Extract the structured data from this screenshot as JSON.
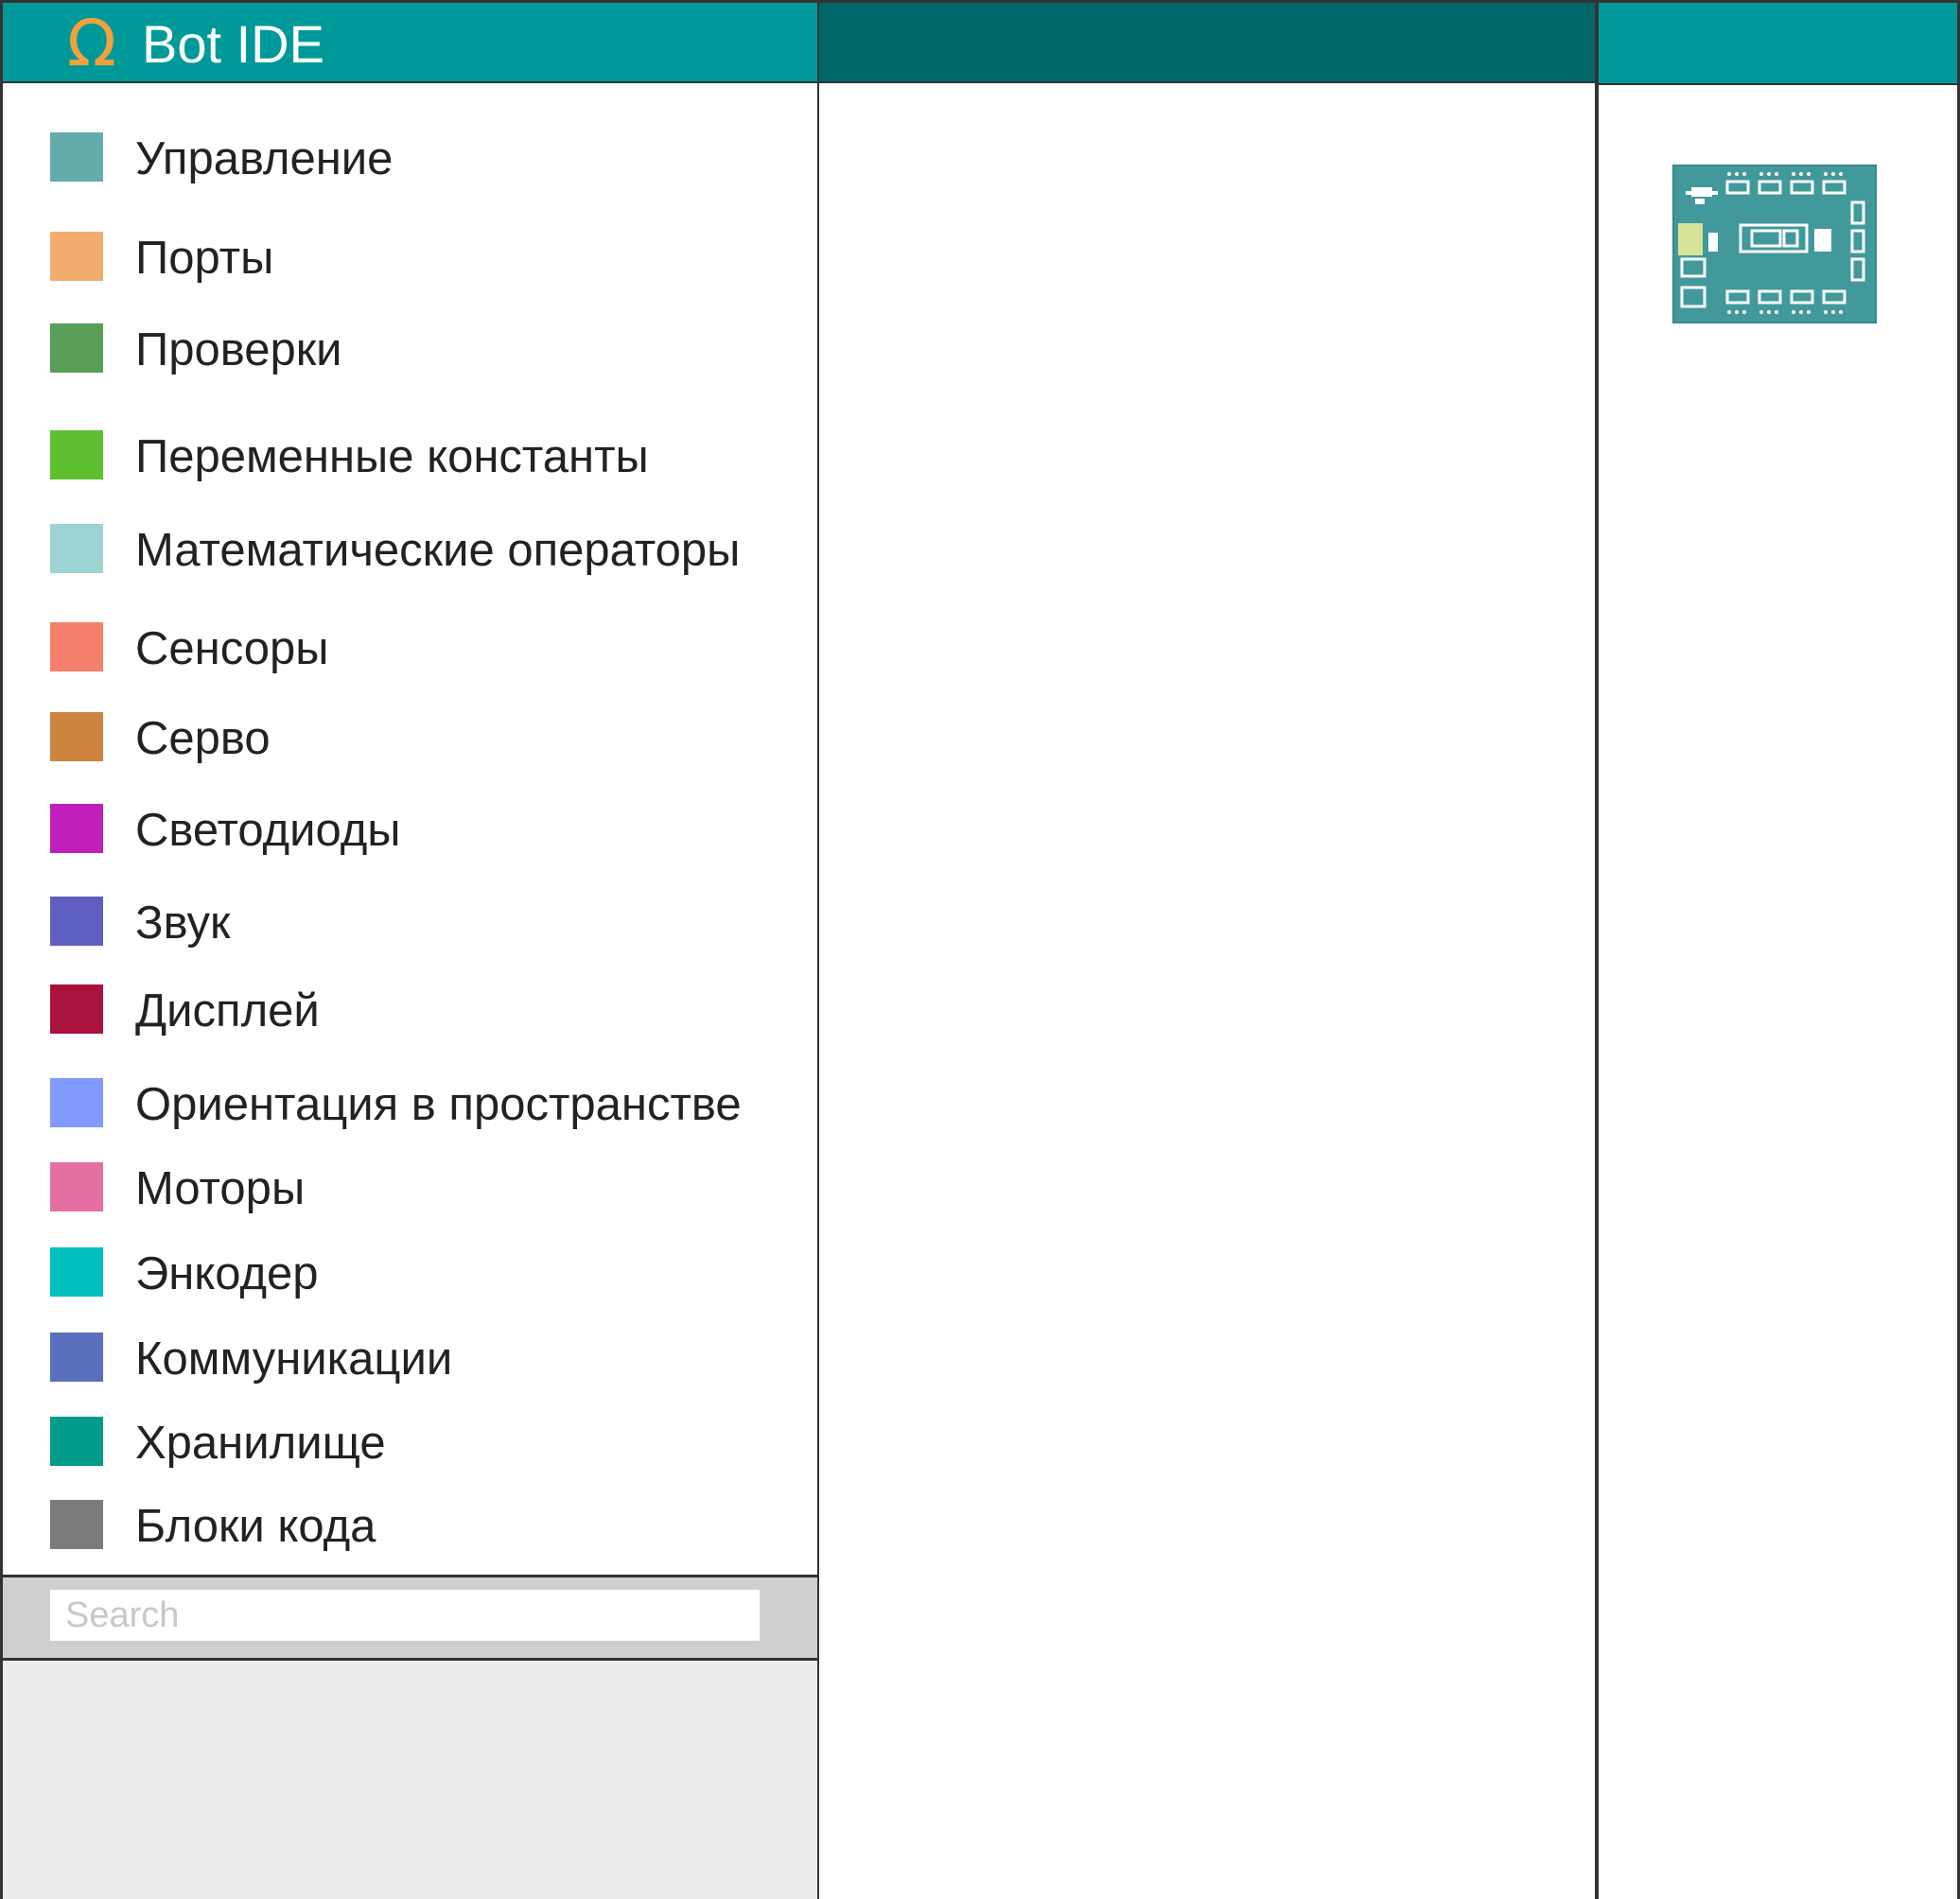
{
  "app": {
    "logo_glyph": "Ω",
    "title": "Bot IDE"
  },
  "categories": [
    {
      "label": "Управление",
      "color": "#64abab"
    },
    {
      "label": "Порты",
      "color": "#f2ad6e"
    },
    {
      "label": "Проверки",
      "color": "#5a9e58"
    },
    {
      "label": "Переменные константы",
      "color": "#5ebf31"
    },
    {
      "label": "Математические операторы",
      "color": "#9ed3d3"
    },
    {
      "label": "Сенсоры",
      "color": "#f4806b"
    },
    {
      "label": "Серво",
      "color": "#cd843f"
    },
    {
      "label": "Светодиоды",
      "color": "#c01fb9"
    },
    {
      "label": "Звук",
      "color": "#5f5fc2"
    },
    {
      "label": "Дисплей",
      "color": "#a8123b"
    },
    {
      "label": "Ориентация в пространстве",
      "color": "#8299ff"
    },
    {
      "label": "Моторы",
      "color": "#e66fa2"
    },
    {
      "label": "Энкодер",
      "color": "#00bfbf"
    },
    {
      "label": "Коммуникации",
      "color": "#5a6fbd"
    },
    {
      "label": "Хранилище",
      "color": "#009b8b"
    },
    {
      "label": "Блоки кода",
      "color": "#7b7b7b"
    }
  ],
  "search": {
    "placeholder": "Search",
    "value": ""
  },
  "colors": {
    "header_teal": "#009999",
    "workspace_header": "#006668",
    "board": "#41999b",
    "board_highlight": "#d8e39a"
  },
  "board_image": {
    "icon": "controller-board-icon"
  }
}
